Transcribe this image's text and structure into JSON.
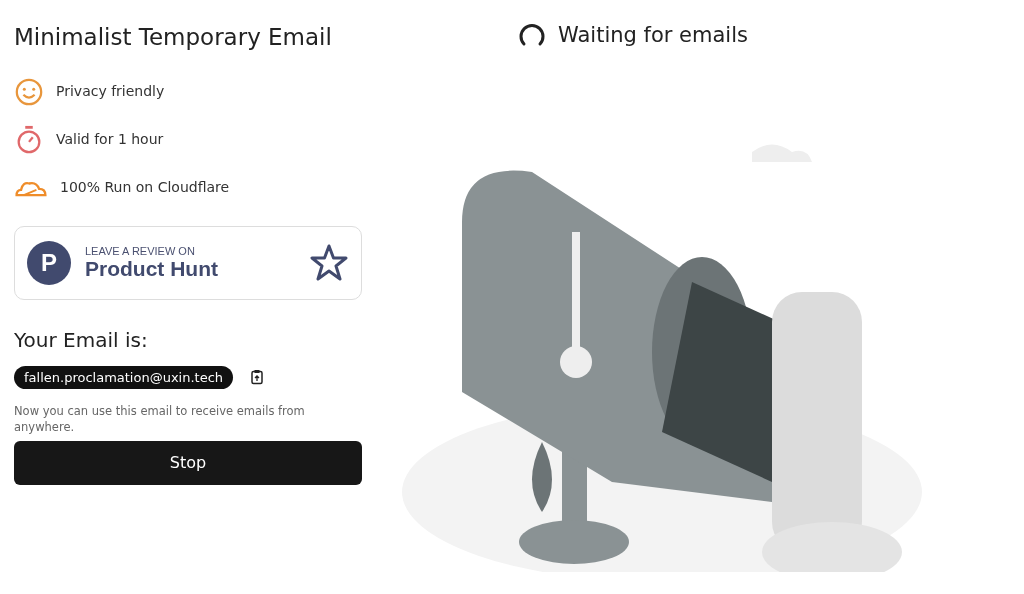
{
  "title": "Minimalist Temporary Email",
  "features": [
    {
      "kind": "smile",
      "label": "Privacy friendly",
      "color": "#e8963c"
    },
    {
      "kind": "timer",
      "label": "Valid for 1 hour",
      "color": "#e0686a"
    },
    {
      "kind": "cloud",
      "label": "100% Run on Cloudflare",
      "color": "#ef8d2a"
    }
  ],
  "review_badge": {
    "logo_letter": "P",
    "caption": "LEAVE A REVIEW ON",
    "name": "Product Hunt"
  },
  "email_heading": "Your Email is:",
  "email": "fallen.proclamation@uxin.tech",
  "note": "Now you can use this email to receive emails from anywhere.",
  "stop_button": "Stop",
  "status": "Waiting for emails"
}
